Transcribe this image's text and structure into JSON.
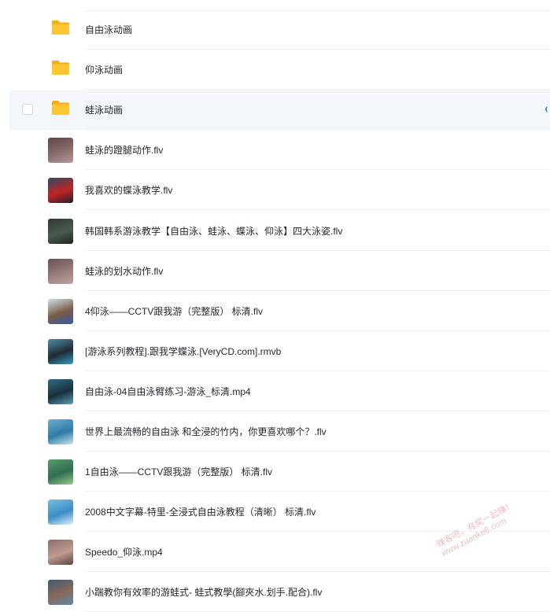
{
  "files": [
    {
      "name": "自由泳动画",
      "type": "folder"
    },
    {
      "name": "仰泳动画",
      "type": "folder"
    },
    {
      "name": "蛙泳动画",
      "type": "folder",
      "selected_hover": true
    },
    {
      "name": "蛙泳的蹬腿动作.flv",
      "type": "video",
      "thumb": [
        "#5f4648",
        "#8a6d6e",
        "#b79a97"
      ]
    },
    {
      "name": "我喜欢的蝶泳教学.flv",
      "type": "video",
      "thumb": [
        "#2c4a66",
        "#c02424",
        "#1f1f2e"
      ]
    },
    {
      "name": "韩国韩系游泳教学【自由泳、蛙泳、蝶泳、仰泳】四大泳姿.flv",
      "type": "video",
      "thumb": [
        "#2d3a33",
        "#4a5a4e",
        "#1c2520"
      ]
    },
    {
      "name": "蛙泳的划水动作.flv",
      "type": "video",
      "thumb": [
        "#6a5152",
        "#9a7d7d",
        "#c0a3a0"
      ]
    },
    {
      "name": "4仰泳——CCTV跟我游（完整版） 标清.flv",
      "type": "video",
      "thumb": [
        "#cfe0ea",
        "#7a5a46",
        "#2f5fa8"
      ]
    },
    {
      "name": "[游泳系列教程].跟我学蝶泳.[VeryCD.com].rmvb",
      "type": "video",
      "thumb": [
        "#4f8fa8",
        "#1f2a36",
        "#2fa0c0"
      ]
    },
    {
      "name": "自由泳-04自由泳臂练习-游泳_标清.mp4",
      "type": "video",
      "thumb": [
        "#2d6e88",
        "#1a2f3c",
        "#5aa0b8"
      ]
    },
    {
      "name": "世界上最流畅的自由泳 和全浸的竹内，你更喜欢哪个？.flv",
      "type": "video",
      "thumb": [
        "#6ab0d0",
        "#2e7ca8",
        "#c8e4f0"
      ]
    },
    {
      "name": "1自由泳——CCTV跟我游（完整版） 标清.flv",
      "type": "video",
      "thumb": [
        "#5a9a6a",
        "#2e7050",
        "#9ac890"
      ]
    },
    {
      "name": "2008中文字幕-特里-全浸式自由泳教程（清晰） 标清.flv",
      "type": "video",
      "thumb": [
        "#78c0e0",
        "#3a8cc8",
        "#e0f0f8"
      ]
    },
    {
      "name": "Speedo_仰泳.mp4",
      "type": "video",
      "thumb": [
        "#8a6e6a",
        "#c09a90",
        "#5a4440"
      ]
    },
    {
      "name": "小踹教你有效率的游蛙式- 蛙式教學(腳夾水.划手.配合).flv",
      "type": "video",
      "thumb": [
        "#3a5a78",
        "#8a6a58",
        "#5a88b0"
      ]
    }
  ],
  "colors": {
    "folder": "#ffc533",
    "folder_dark": "#f5ad14",
    "hover_row": "#f3f6fb",
    "accent": "#3b8cf0"
  },
  "watermark": {
    "line1": "赚客吧，有奖一起赚！",
    "line2": "www.zuanke8.com"
  }
}
